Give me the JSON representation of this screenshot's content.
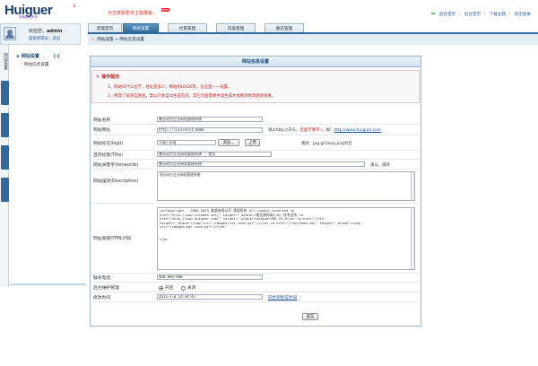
{
  "header": {
    "logo": "Huiguer",
    "logo_mark": "E",
    "logo_sub": "惠格建站系统",
    "promo": "点击获取更多主题模板...",
    "promo_badge": "NEW",
    "links": [
      "后台首页",
      "前台首页",
      "下载主题",
      "退出登录"
    ]
  },
  "user": {
    "welcome": "欢迎您，",
    "name": "admin",
    "role": "超级管理员 - 退出"
  },
  "tabs": [
    {
      "label": "管理首页",
      "active": false
    },
    {
      "label": "系统设置",
      "active": true
    },
    {
      "label": "栏目管理",
      "active": false
    },
    {
      "label": "内容管理",
      "active": false
    },
    {
      "label": "静态管理",
      "active": false
    }
  ],
  "breadcrumb": "网站设置 → 网站信息设置",
  "sidebar": {
    "vtabs": [
      "网站设置",
      "",
      "",
      "",
      "",
      ""
    ],
    "title": "网站设置",
    "toggle": "[-]",
    "items": [
      "网站信息设置"
    ]
  },
  "panel": {
    "title": "网站信息设置",
    "tip_title": "操作提示",
    "tips": [
      "1、网站叫什么名字，地址是多少，网站的LOGO等，在这里一一设置。",
      "2、修改了某项信息后，默认只会自动生成首页，其它页面需要手动生成才会看到修改后的效果。"
    ]
  },
  "form": {
    "site_name": {
      "label": "网站名称",
      "value": "慧谷动力企业网站管理系统"
    },
    "site_url": {
      "label": "网站网址",
      "value": "http://localhost:8080",
      "hint_pre": "请以http://开头，",
      "hint_red": "后面不要带 /",
      "hint_mid": "，如：",
      "hint_link": "http://www.huiguer.com"
    },
    "logo": {
      "label": "网站标志(logo)",
      "value": "logo.png",
      "browse": "浏览...",
      "upload": "上传",
      "hint": "格式：jpg,gif,bmp,png为佳"
    },
    "title": {
      "label": "首页标题(Title)",
      "value": "慧谷动力企业网站管理系统 - 首页"
    },
    "keywords": {
      "label": "网站关键字(keywords)",
      "value": "慧谷动力企业网站管理系统",
      "hint": "请以，隔开"
    },
    "description": {
      "label": "网站描述(Description)",
      "value": "慧谷动力企业网站管理系统"
    },
    "footer": {
      "label": "网站底部HTML代码",
      "value": "<p>Copyright   2009-2013 某某有限公司 版权所有 All rights reserved <a\nhref=\"http://www.zzcodes.net/\" target=\"_blank\">商业源码网</a> 技术支持 <a\nhref=\"http://www.huiguer.com/\" target=\"_blank\">HuiguerCMS V3.0</a> <a href=\"/rss\"\ntarget=\"_blank\"><img src=\"/images/rss_icon.gif\"/></a> <a href=\"/rss/feed.xml\" target=\"_blank\"><img\nsrc=\"/images/xml_icon.gif\"/></a>\n\n\n</p>"
    },
    "phone": {
      "label": "联系电话",
      "value": "400-888-888"
    },
    "maintenance": {
      "label": "后台维护管理",
      "on": "开启",
      "off": "关闭"
    },
    "modified": {
      "label": "修改时间",
      "value": "2013-1-6 14:34:43",
      "sync": "同步到现在时间"
    },
    "submit": "提交"
  },
  "colors": {
    "accent": "#2f6a9a",
    "tip_red": "#c02020",
    "link": "#1a4d9a"
  }
}
